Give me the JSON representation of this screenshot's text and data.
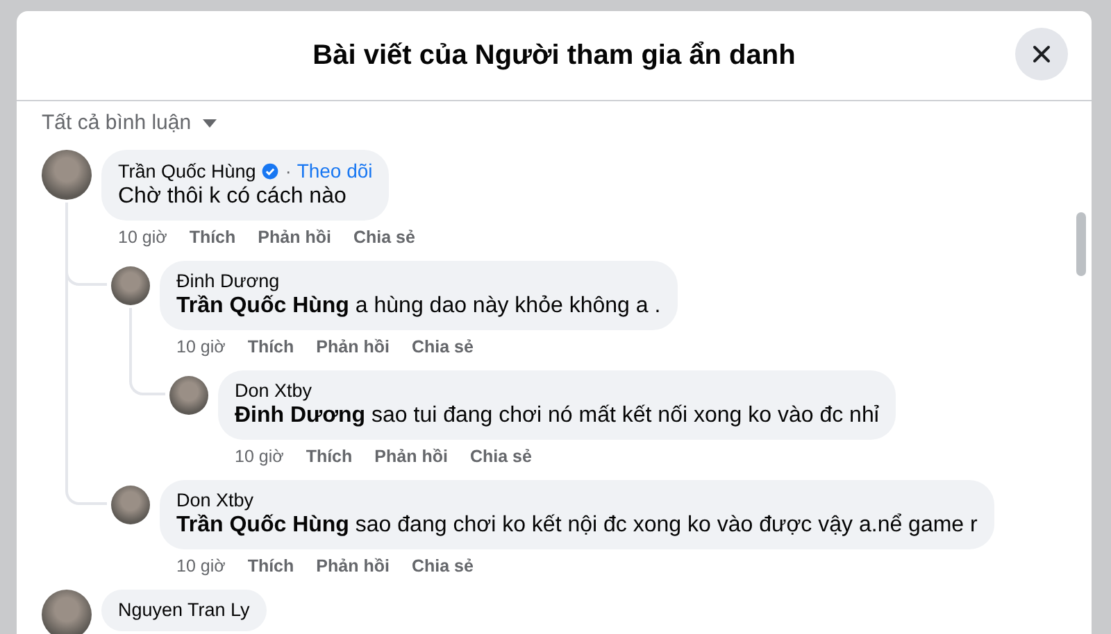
{
  "dialog": {
    "title": "Bài viết của Người tham gia ẩn danh"
  },
  "filter": {
    "label": "Tất cả bình luận"
  },
  "comments": [
    {
      "author": "Trần Quốc Hùng",
      "verified": true,
      "follow_separator": "·",
      "follow": "Theo dõi",
      "text": "Chờ thôi k có cách nào",
      "time": "10 giờ",
      "actions": [
        "Thích",
        "Phản hồi",
        "Chia sẻ"
      ],
      "children": [
        {
          "author": "Đinh Dương",
          "mention": "Trần Quốc Hùng",
          "text": "a hùng dao này khỏe không a .",
          "time": "10 giờ",
          "actions": [
            "Thích",
            "Phản hồi",
            "Chia sẻ"
          ],
          "children": [
            {
              "author": "Don Xtby",
              "mention": "Đinh Dương",
              "text": "sao tui đang chơi nó mất kết nối xong ko vào đc nhỉ",
              "time": "10 giờ",
              "actions": [
                "Thích",
                "Phản hồi",
                "Chia sẻ"
              ]
            }
          ]
        },
        {
          "author": "Don Xtby",
          "mention": "Trần Quốc Hùng",
          "text": "sao đang chơi ko kết nội đc xong ko vào được vậy a.nể game r",
          "time": "10 giờ",
          "actions": [
            "Thích",
            "Phản hồi",
            "Chia sẻ"
          ]
        }
      ]
    },
    {
      "author": "Nguyen Tran Ly"
    }
  ]
}
